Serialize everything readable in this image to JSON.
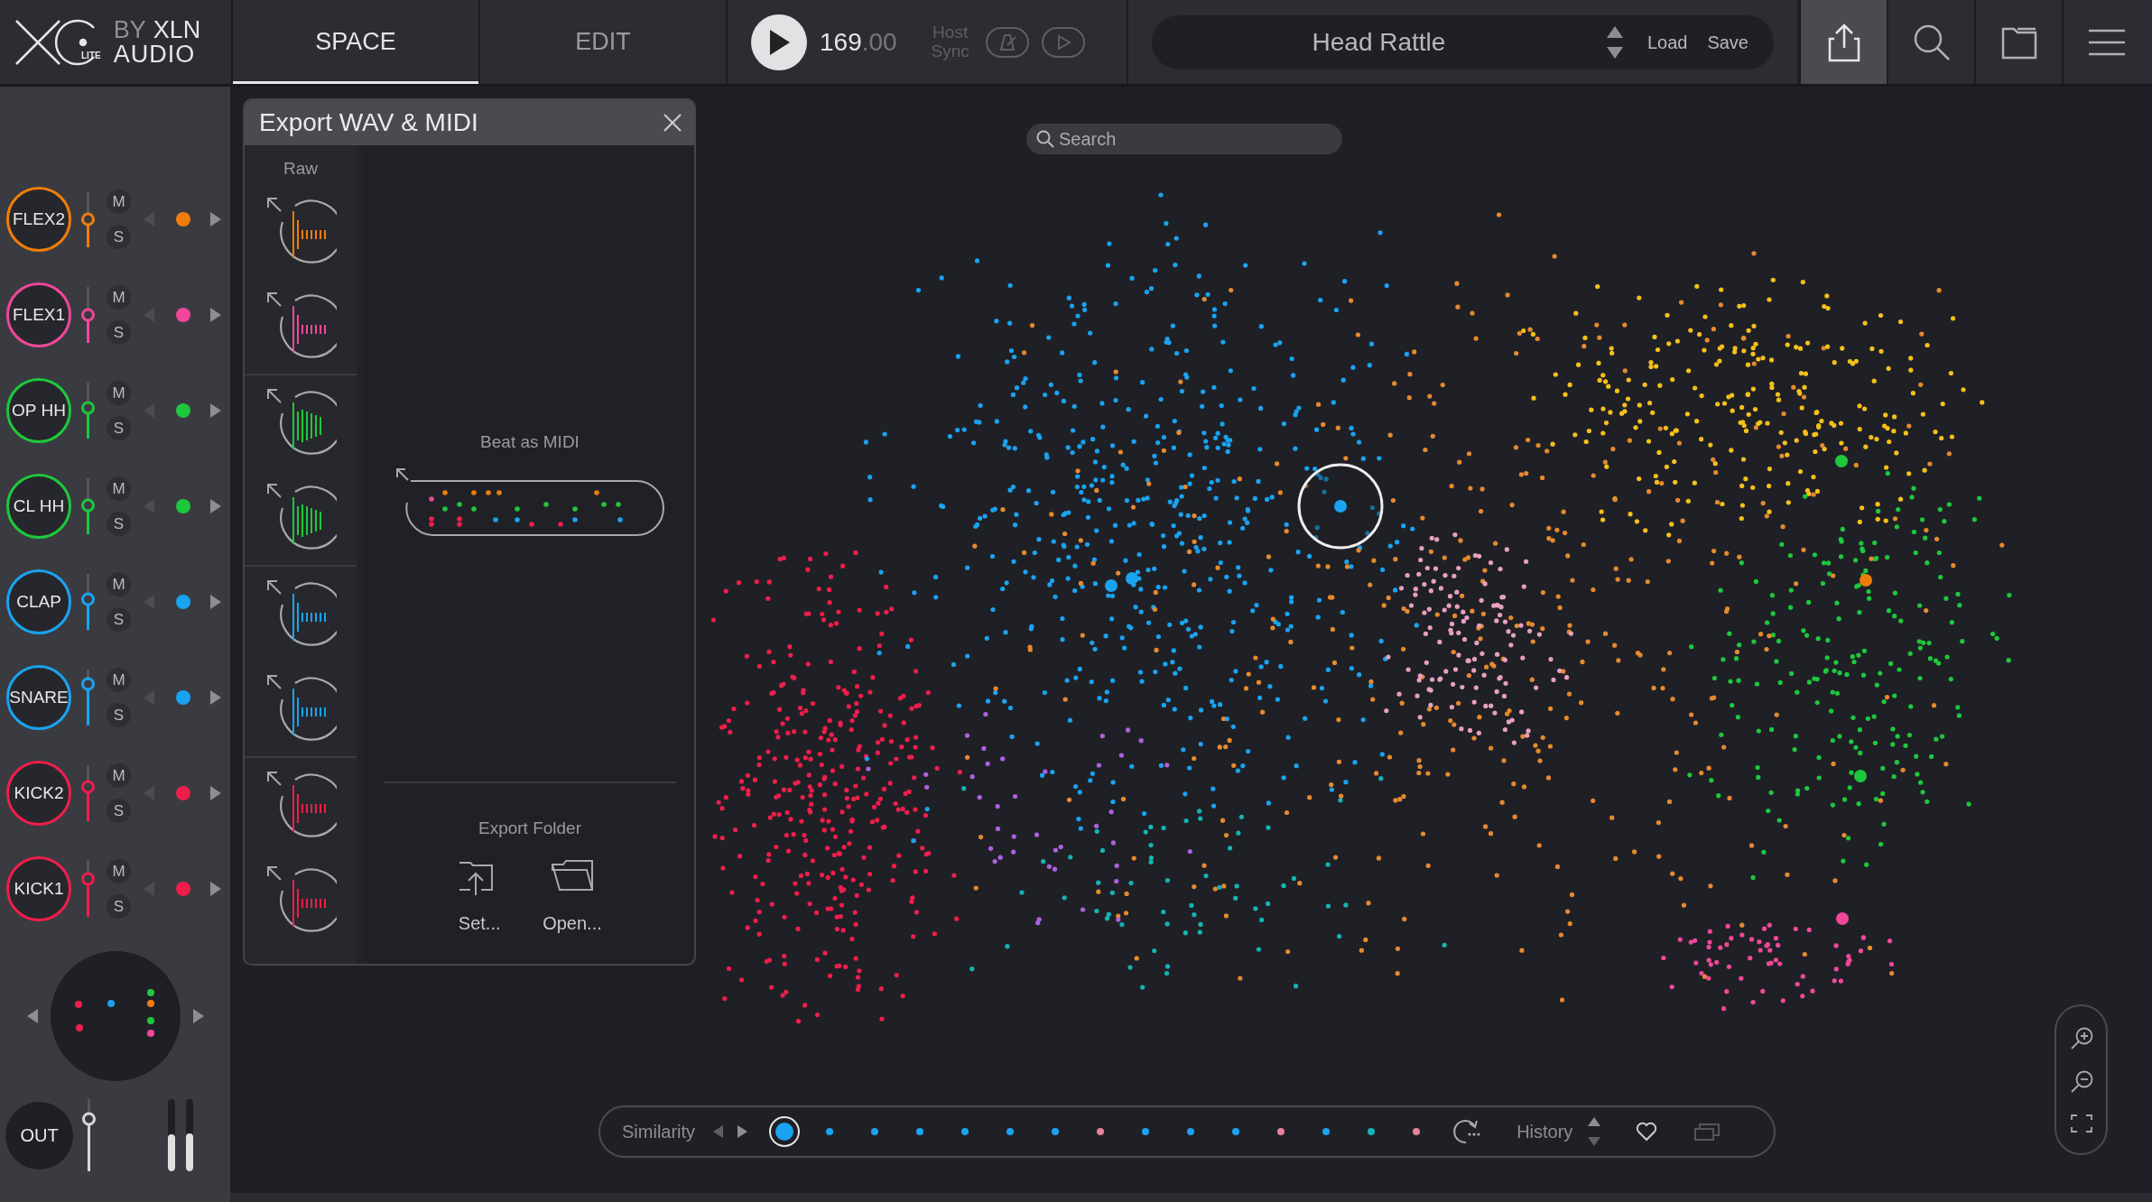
{
  "logo": {
    "by": "BY",
    "brand": "XLN",
    "maker": "AUDIO",
    "edition": "LITE"
  },
  "tabs": [
    {
      "label": "SPACE",
      "selected": true
    },
    {
      "label": "EDIT",
      "selected": false
    }
  ],
  "tempo": {
    "whole": "169",
    "fraction": ".00"
  },
  "host_sync": "Host Sync",
  "preset": {
    "name": "Head Rattle",
    "load": "Load",
    "save": "Save"
  },
  "toolbar": [
    {
      "kind": "export",
      "selected": true
    },
    {
      "kind": "search",
      "selected": false
    },
    {
      "kind": "folder",
      "selected": false
    },
    {
      "kind": "menu",
      "selected": false
    }
  ],
  "tracks": [
    {
      "name": "FLEX2",
      "color": "#f07d0a",
      "level": 0.5,
      "mute": "M",
      "solo": "S"
    },
    {
      "name": "FLEX1",
      "color": "#f0479a",
      "level": 0.5,
      "mute": "M",
      "solo": "S"
    },
    {
      "name": "OP HH",
      "color": "#1ec83c",
      "level": 0.55,
      "mute": "M",
      "solo": "S"
    },
    {
      "name": "CL HH",
      "color": "#1ec83c",
      "level": 0.52,
      "mute": "M",
      "solo": "S"
    },
    {
      "name": "CLAP",
      "color": "#1aa3f0",
      "level": 0.55,
      "mute": "M",
      "solo": "S"
    },
    {
      "name": "SNARE",
      "color": "#1aa3f0",
      "level": 0.75,
      "mute": "M",
      "solo": "S"
    },
    {
      "name": "KICK2",
      "color": "#ee1e4b",
      "level": 0.62,
      "mute": "M",
      "solo": "S"
    },
    {
      "name": "KICK1",
      "color": "#ee1e4b",
      "level": 0.67,
      "mute": "M",
      "solo": "S"
    }
  ],
  "output": {
    "label": "OUT",
    "level": 0.72,
    "meters": [
      {
        "level": 0.51
      },
      {
        "level": 0.53
      }
    ]
  },
  "search": {
    "placeholder": "Search"
  },
  "export_panel": {
    "title": "Export WAV & MIDI",
    "raw_label": "Raw",
    "raw_items": [
      {
        "color": "#f07d0a"
      },
      {
        "color": "#f0479a"
      },
      {
        "color": "#1ec83c"
      },
      {
        "color": "#1ec83c"
      },
      {
        "color": "#1aa3f0"
      },
      {
        "color": "#1aa3f0"
      },
      {
        "color": "#ee1e4b"
      },
      {
        "color": "#ee1e4b"
      }
    ],
    "midi_label": "Beat as MIDI",
    "folder_label": "Export Folder",
    "buttons": [
      {
        "kind": "set",
        "label": "Set..."
      },
      {
        "kind": "open",
        "label": "Open..."
      }
    ]
  },
  "similarity": {
    "label": "Similarity",
    "items": [
      {
        "selected": true,
        "color": "#1aa3f0"
      },
      {
        "selected": false,
        "color": "#1aa3f0"
      },
      {
        "selected": false,
        "color": "#1aa3f0"
      },
      {
        "selected": false,
        "color": "#1aa3f0"
      },
      {
        "selected": false,
        "color": "#1aa3f0"
      },
      {
        "selected": false,
        "color": "#1aa3f0"
      },
      {
        "selected": false,
        "color": "#1aa3f0"
      },
      {
        "selected": false,
        "color": "#e8819e"
      },
      {
        "selected": false,
        "color": "#1aa3f0"
      },
      {
        "selected": false,
        "color": "#1aa3f0"
      },
      {
        "selected": false,
        "color": "#1aa3f0"
      },
      {
        "selected": false,
        "color": "#e8819e"
      },
      {
        "selected": false,
        "color": "#1aa3f0"
      },
      {
        "selected": false,
        "color": "#14b4b4"
      },
      {
        "selected": false,
        "color": "#e8819e"
      }
    ]
  },
  "history": {
    "label": "History"
  }
}
